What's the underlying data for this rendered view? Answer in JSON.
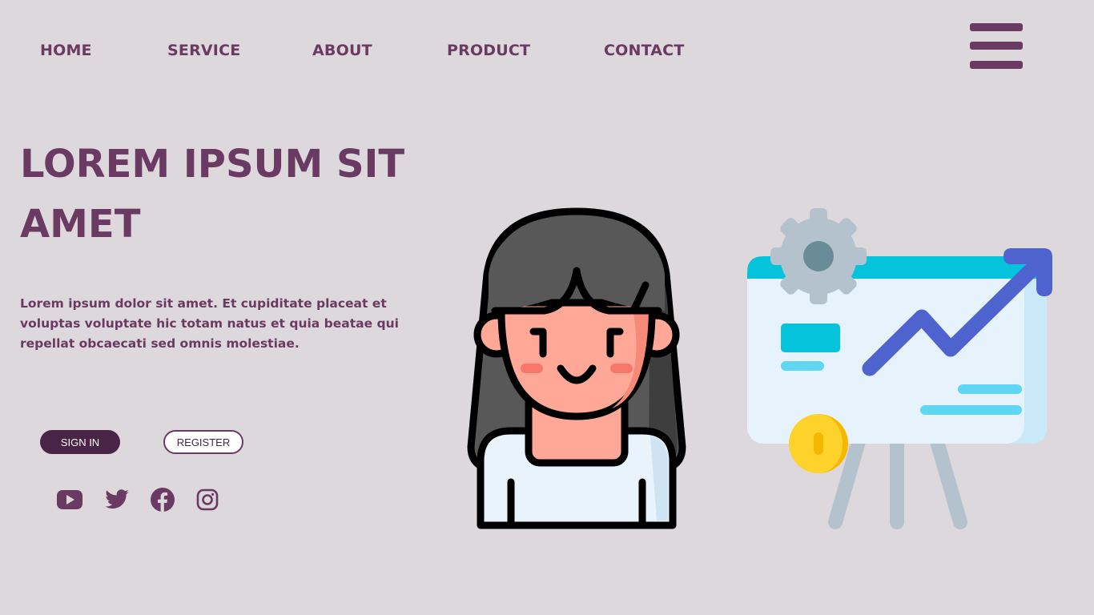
{
  "nav": {
    "items": [
      {
        "label": "HOME"
      },
      {
        "label": "SERVICE"
      },
      {
        "label": "ABOUT"
      },
      {
        "label": "PRODUCT"
      },
      {
        "label": "CONTACT"
      }
    ],
    "menu_icon": "hamburger-menu-icon"
  },
  "hero": {
    "title": "LOREM IPSUM SIT AMET",
    "body": "Lorem ipsum dolor sit amet. Et cupiditate placeat et voluptas voluptate hic totam natus et quia beatae qui repellat obcaecati sed omnis molestiae."
  },
  "buttons": {
    "sign_in": "SIGN IN",
    "register": "REGISTER"
  },
  "social": {
    "icons": [
      "youtube-icon",
      "twitter-icon",
      "facebook-icon",
      "instagram-icon"
    ]
  },
  "illustrations": {
    "person": "woman-avatar-illustration",
    "board": "growth-chart-presentation-board-illustration"
  },
  "colors": {
    "background": "#ddd8dc",
    "accent": "#6b3a63",
    "button_dark": "#4a2446"
  }
}
